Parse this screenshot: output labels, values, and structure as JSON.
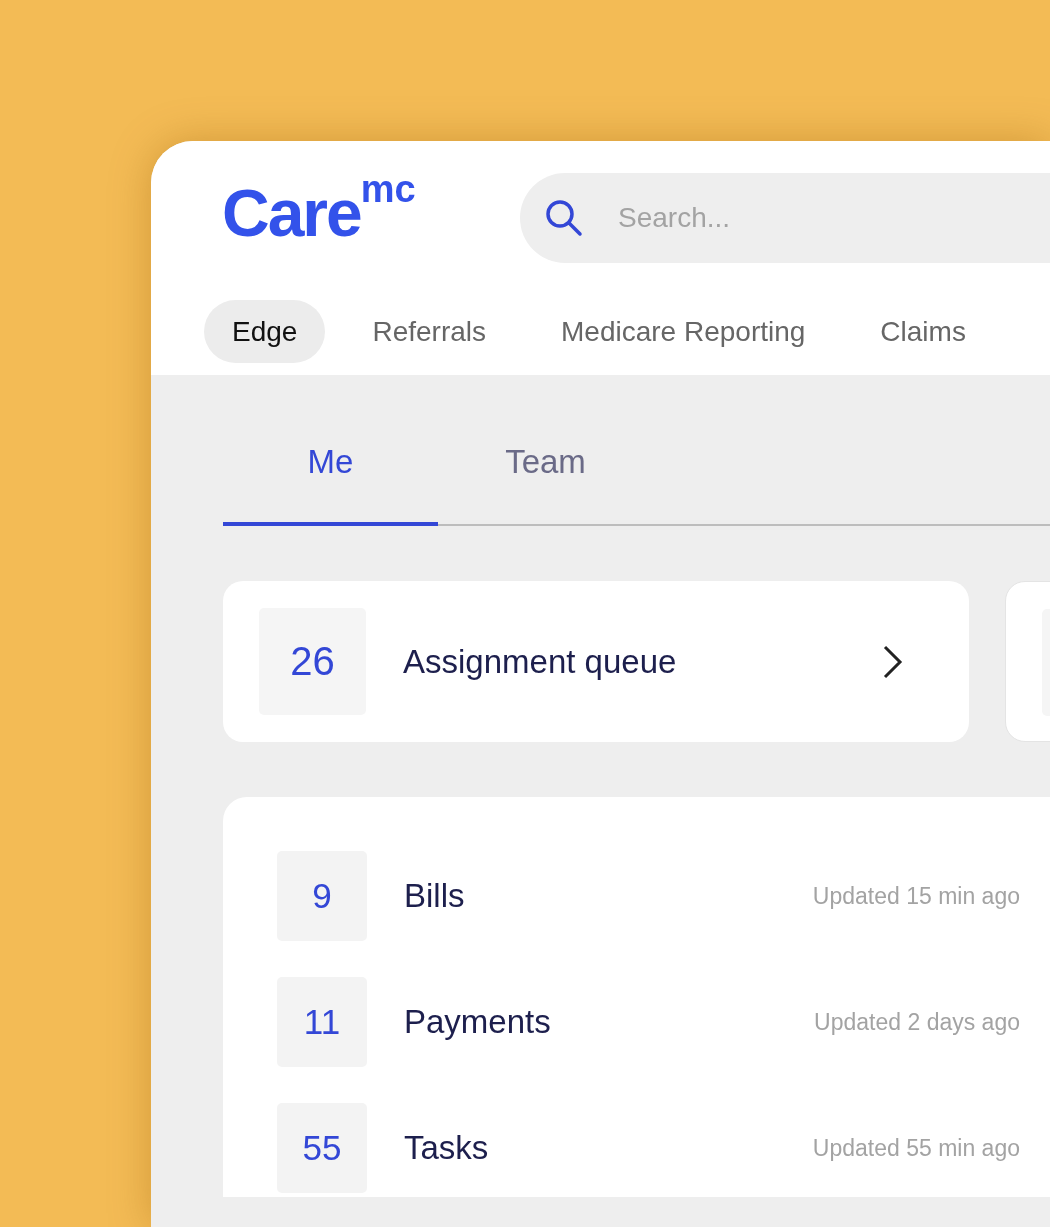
{
  "logo": "Care$^{mc}$",
  "search": {
    "placeholder": "Search..."
  },
  "nav_tabs": [
    {
      "label": "Edge",
      "selected": true
    },
    {
      "label": "Referrals",
      "selected": false
    },
    {
      "label": "Medicare Reporting",
      "selected": false
    },
    {
      "label": "Claims",
      "selected": false
    }
  ],
  "view_tabs": [
    {
      "label": "Me",
      "selected": true
    },
    {
      "label": "Team",
      "selected": false
    }
  ],
  "queue_card": {
    "count": "26",
    "label": "Assignment queue"
  },
  "items": [
    {
      "count": "9",
      "label": "Bills",
      "updated": "Updated 15 min ago"
    },
    {
      "count": "11",
      "label": "Payments",
      "updated": "Updated 2 days ago"
    },
    {
      "count": "55",
      "label": "Tasks",
      "updated": "Updated 55 min ago"
    }
  ]
}
